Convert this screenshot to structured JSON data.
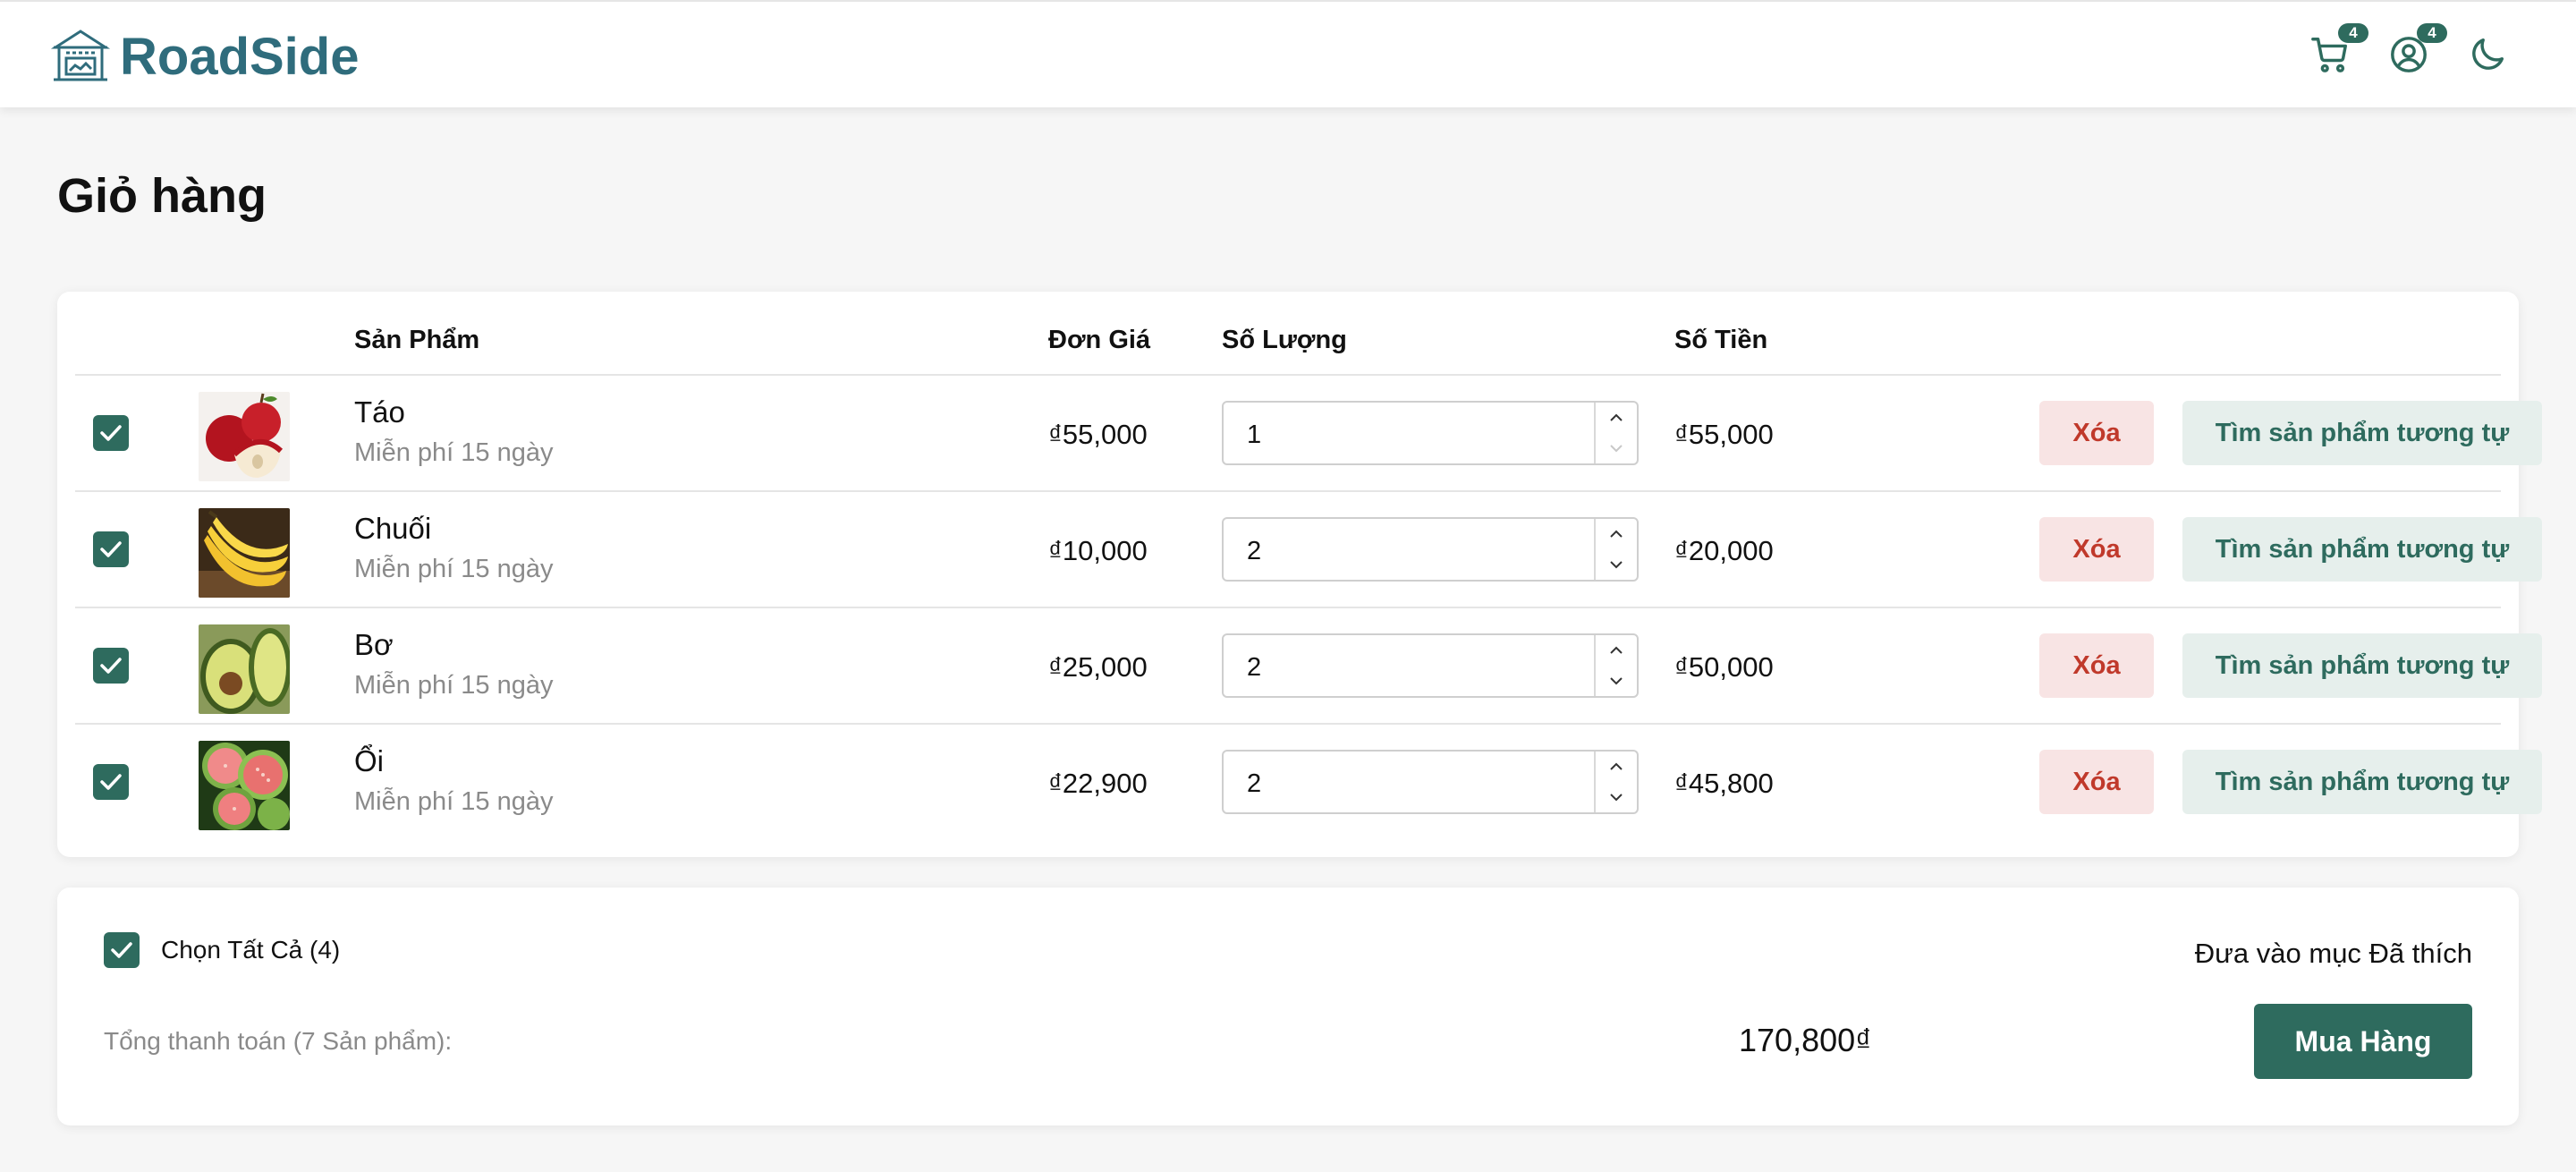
{
  "brand": {
    "name": "RoadSide",
    "color": "#2f6c7c"
  },
  "header": {
    "cart_count": "4",
    "account_count": "4"
  },
  "page_title": "Giỏ hàng",
  "table": {
    "columns": [
      "Sản Phẩm",
      "Đơn Giá",
      "Số Lượng",
      "Số Tiền"
    ],
    "rows": [
      {
        "name": "Táo",
        "note": "Miễn phí 15 ngày",
        "price": "₫55,000",
        "qty": "1",
        "amount": "₫55,000",
        "delete_label": "Xóa",
        "similar_label": "Tìm sản phẩm tương tự",
        "image": "apple"
      },
      {
        "name": "Chuối",
        "note": "Miễn phí 15 ngày",
        "price": "₫10,000",
        "qty": "2",
        "amount": "₫20,000",
        "delete_label": "Xóa",
        "similar_label": "Tìm sản phẩm tương tự",
        "image": "banana"
      },
      {
        "name": "Bơ",
        "note": "Miễn phí 15 ngày",
        "price": "₫25,000",
        "qty": "2",
        "amount": "₫50,000",
        "delete_label": "Xóa",
        "similar_label": "Tìm sản phẩm tương tự",
        "image": "avocado"
      },
      {
        "name": "Ổi",
        "note": "Miễn phí 15 ngày",
        "price": "₫22,900",
        "qty": "2",
        "amount": "₫45,800",
        "delete_label": "Xóa",
        "similar_label": "Tìm sản phẩm tương tự",
        "image": "guava"
      }
    ]
  },
  "summary": {
    "select_all_label": "Chọn Tất Cả (4)",
    "favorite_link": "Đưa vào mục Đã thích",
    "total_label": "Tổng thanh toán (7 Sản phẩm):",
    "total_value": "170,800₫",
    "buy_label": "Mua Hàng"
  },
  "colors": {
    "primary": "#2e6b5e",
    "danger": "#c0392b",
    "danger_bg": "#f8e4e4",
    "secondary_bg": "#e6efec"
  },
  "icons": [
    "storefront-icon",
    "cart-icon",
    "account-icon",
    "moon-icon",
    "check-icon",
    "chevron-up-icon",
    "chevron-down-icon"
  ]
}
